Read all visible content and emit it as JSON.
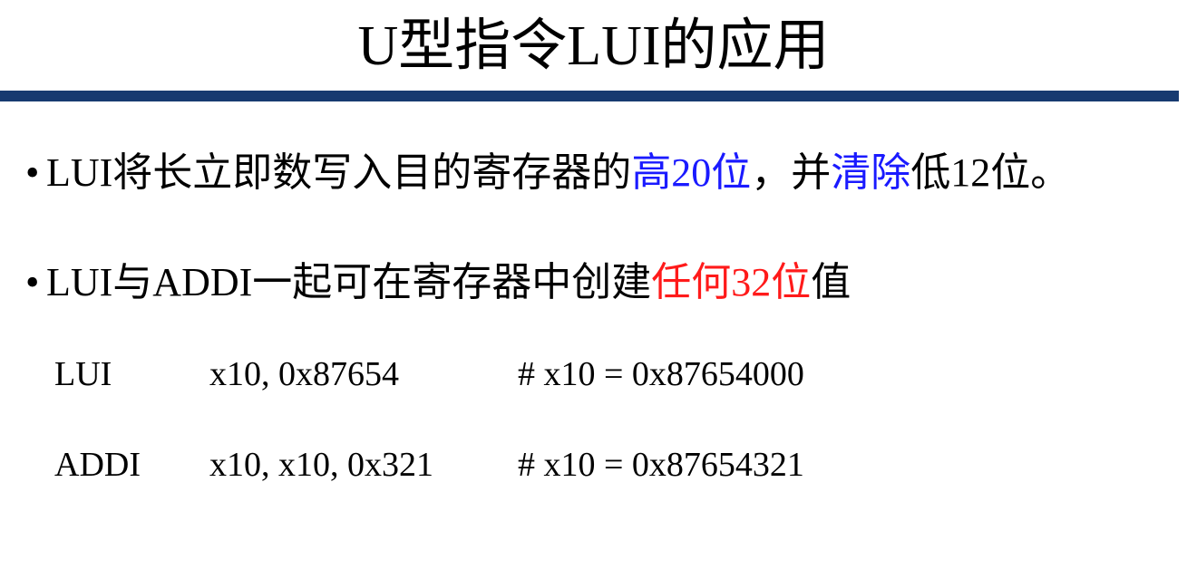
{
  "title": "U型指令LUI的应用",
  "colors": {
    "title_rule": "#173a70",
    "blue_emphasis": "#1a1aff",
    "red_emphasis": "#ff1a1a"
  },
  "bullet_glyph": "•",
  "bullet1": {
    "pre": "LUI将长立即数写入目的寄存器的",
    "emph1": "高20位",
    "mid": "，并",
    "emph2": "清除",
    "post": "低12位。"
  },
  "bullet2": {
    "pre": "LUI与ADDI一起可在寄存器中创建",
    "emph": "任何32位",
    "post": "值"
  },
  "code": [
    {
      "op": "LUI",
      "args": "x10, 0x87654",
      "comment": "# x10 = 0x87654000"
    },
    {
      "op": "ADDI",
      "args": "x10, x10, 0x321",
      "comment": "# x10 = 0x87654321"
    }
  ]
}
